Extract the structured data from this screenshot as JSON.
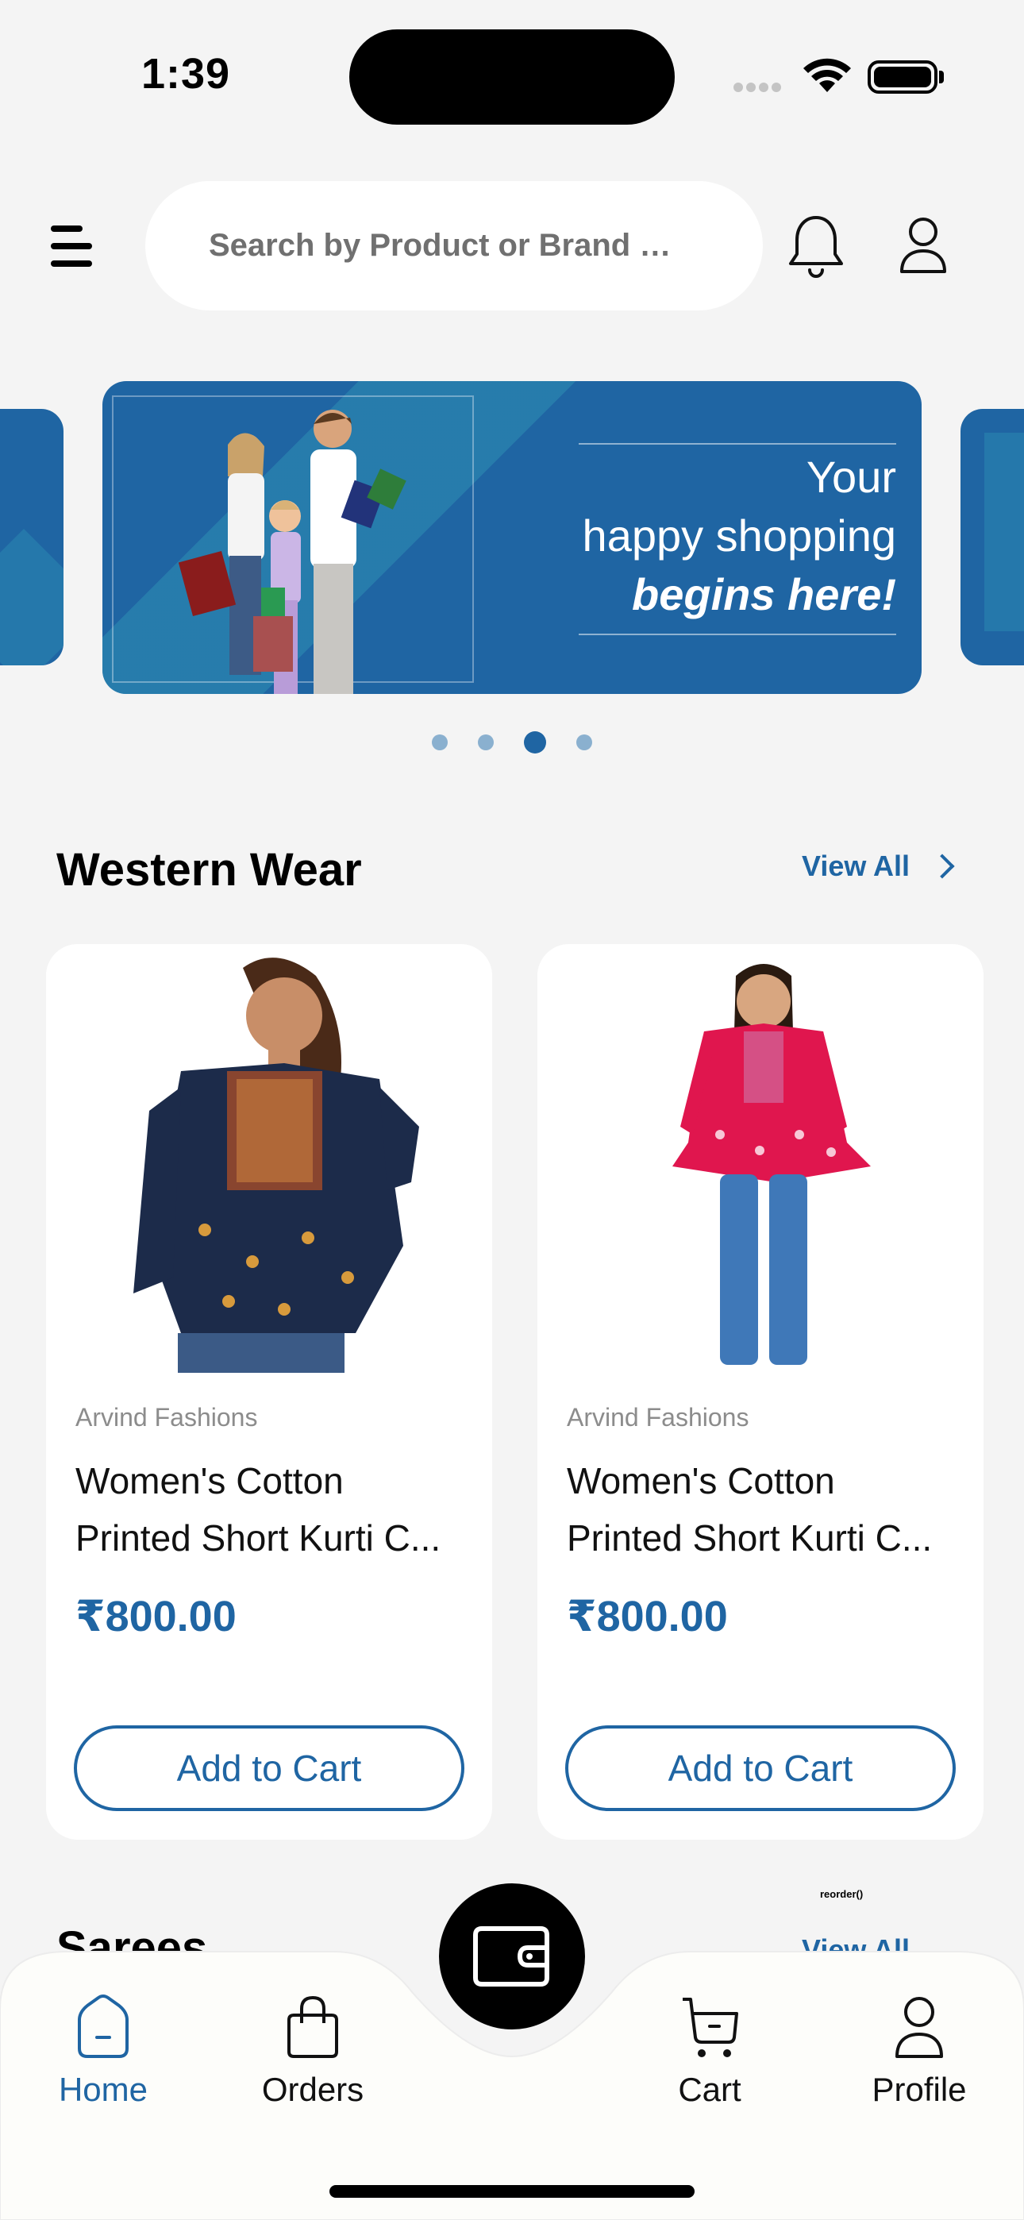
{
  "status": {
    "time": "1:39"
  },
  "search": {
    "placeholder": "Search by Product or Brand Na..."
  },
  "banner": {
    "line1": "Your",
    "line2": "happy shopping",
    "line3": "begins here!"
  },
  "carousel": {
    "count": 4,
    "active_index": 2
  },
  "western": {
    "title": "Western Wear",
    "view_all": "View All",
    "products": [
      {
        "brand": "Arvind Fashions",
        "name_line1": "Women's Cotton",
        "name_line2": "Printed Short Kurti C...",
        "price": "₹800.00",
        "button": "Add to Cart",
        "icon": "navy-kurti-image"
      },
      {
        "brand": "Arvind Fashions",
        "name_line1": "Women's Cotton",
        "name_line2": "Printed Short Kurti C...",
        "price": "₹800.00",
        "button": "Add to Cart",
        "icon": "pink-kurti-image"
      }
    ]
  },
  "sarees": {
    "title": "Sarees",
    "view_all": "View All"
  },
  "reorder": {
    "label": "reorder()"
  },
  "nav": {
    "items": [
      {
        "label": "Home",
        "icon": "home-icon",
        "active": true
      },
      {
        "label": "Orders",
        "icon": "bag-icon",
        "active": false
      },
      {
        "label": "Cart",
        "icon": "cart-icon",
        "active": false
      },
      {
        "label": "Profile",
        "icon": "profile-icon",
        "active": false
      }
    ],
    "fab_icon": "wallet-icon"
  },
  "colors": {
    "accent": "#1f65a3",
    "background": "#f4f4f4"
  }
}
